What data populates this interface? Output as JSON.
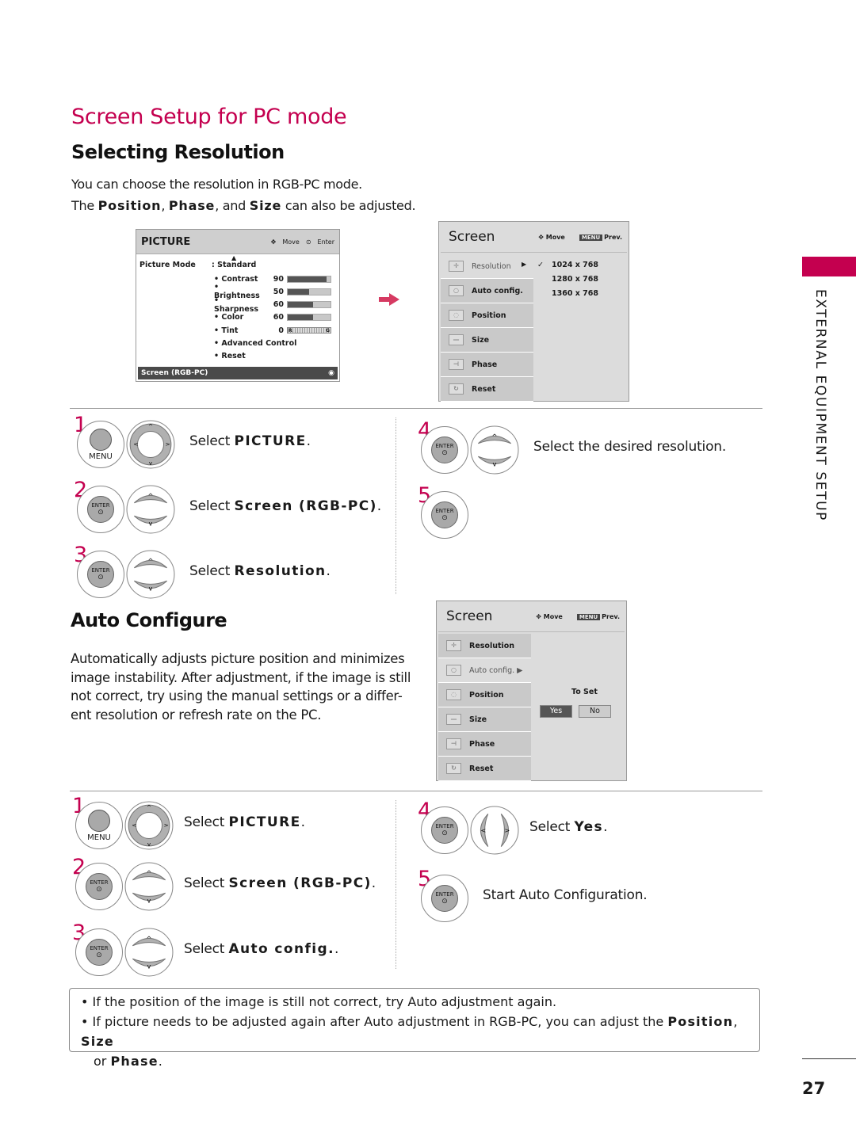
{
  "accent_color": "#c4004f",
  "page_title": "Screen Setup for PC mode",
  "side_tab": {
    "label": "EXTERNAL EQUIPMENT SETUP"
  },
  "page_number": "27",
  "selecting_resolution": {
    "heading": "Selecting Resolution",
    "intro_line1": "You can choose the resolution in RGB-PC mode.",
    "intro_line2": {
      "pre": "The ",
      "b1": "Position",
      "s1": ", ",
      "b2": "Phase",
      "s2": ", and ",
      "b3": "Size",
      "post": " can also be adjusted."
    },
    "picture_menu": {
      "title": "PICTURE",
      "hint_move": "Move",
      "hint_enter": "Enter",
      "picture_mode_label": "Picture Mode",
      "picture_mode_value": ": Standard",
      "settings": [
        {
          "label": "• Contrast",
          "value": "90",
          "level": 0.9
        },
        {
          "label": "• Brightness",
          "value": "50",
          "level": 0.5
        },
        {
          "label": "• Sharpness",
          "value": "60",
          "level": 0.6
        },
        {
          "label": "• Color",
          "value": "60",
          "level": 0.6
        }
      ],
      "tint": {
        "label": "• Tint",
        "value": "0",
        "left": "R",
        "right": "G"
      },
      "advanced": "• Advanced Control",
      "reset": "• Reset",
      "footer": "Screen (RGB-PC)"
    },
    "screen_menu": {
      "title": "Screen",
      "hint_move": "Move",
      "hint_key": "MENU",
      "hint_prev": "Prev.",
      "items": [
        "Resolution",
        "Auto config.",
        "Position",
        "Size",
        "Phase",
        "Reset"
      ],
      "resolutions": [
        "1024 x 768",
        "1280 x 768",
        "1360 x 768"
      ],
      "selected_resolution": "1024 x 768"
    },
    "steps_left": [
      {
        "num": "1",
        "pre": "Select ",
        "bold": "PICTURE",
        "post": ".",
        "key": "MENU"
      },
      {
        "num": "2",
        "pre": "Select ",
        "bold": "Screen (RGB-PC)",
        "post": ".",
        "key": "ENTER"
      },
      {
        "num": "3",
        "pre": "Select ",
        "bold": "Resolution",
        "post": ".",
        "key": "ENTER"
      }
    ],
    "steps_right": [
      {
        "num": "4",
        "text": "Select the desired resolution.",
        "key": "ENTER"
      },
      {
        "num": "5",
        "key": "ENTER"
      }
    ]
  },
  "auto_configure": {
    "heading": "Auto Configure",
    "body": [
      "Automatically adjusts picture position and minimizes",
      "image instability. After adjustment, if the image is still",
      "not correct, try using the manual settings or a differ-",
      "ent resolution or refresh rate on the PC."
    ],
    "screen_menu": {
      "title": "Screen",
      "hint_move": "Move",
      "hint_key": "MENU",
      "hint_prev": "Prev.",
      "items": [
        "Resolution",
        "Auto config. ▶",
        "Position",
        "Size",
        "Phase",
        "Reset"
      ],
      "to_set": "To Set",
      "yes": "Yes",
      "no": "No"
    },
    "steps_left": [
      {
        "num": "1",
        "pre": "Select ",
        "bold": "PICTURE",
        "post": ".",
        "key": "MENU"
      },
      {
        "num": "2",
        "pre": "Select ",
        "bold": "Screen (RGB-PC)",
        "post": ".",
        "key": "ENTER"
      },
      {
        "num": "3",
        "pre": "Select ",
        "bold": "Auto config.",
        "post": ".",
        "key": "ENTER"
      }
    ],
    "steps_right": [
      {
        "num": "4",
        "pre": "Select ",
        "bold": "Yes",
        "post": ".",
        "key": "ENTER"
      },
      {
        "num": "5",
        "text": "Start Auto Configuration.",
        "key": "ENTER"
      }
    ]
  },
  "notes": {
    "line1": "• If the position of the image is still not correct, try Auto adjustment again.",
    "line2_pre": "• If picture needs to be adjusted again after Auto adjustment in RGB-PC, you can adjust the ",
    "b1": "Position",
    "sep": ", ",
    "b2": "Size",
    "line3_pre": "or ",
    "b3": "Phase",
    "end": "."
  }
}
